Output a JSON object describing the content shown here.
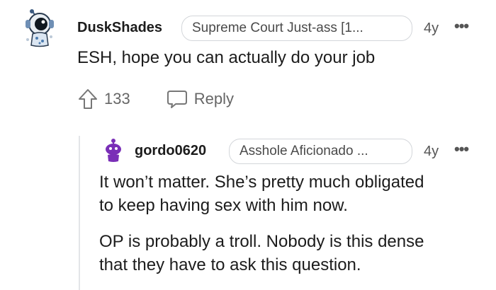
{
  "comment": {
    "author": "DuskShades",
    "flair": "Supreme Court Just-ass [1...",
    "age": "4y",
    "more": "•••",
    "body": "ESH, hope you can actually do your job",
    "upvotes": "133",
    "reply_label": "Reply"
  },
  "reply": {
    "author": "gordo0620",
    "flair": "Asshole Aficionado ...",
    "age": "4y",
    "more": "•••",
    "paragraphs": [
      "It won’t matter. She’s pretty much obligated",
      "to keep having sex with him now.",
      "OP is probably a troll. Nobody is this dense",
      "that they have to ask this question."
    ]
  },
  "colors": {
    "text": "#1c1c1c",
    "muted": "#666666",
    "snoo_purple": "#7a2fb7",
    "border": "#d3d6da"
  }
}
